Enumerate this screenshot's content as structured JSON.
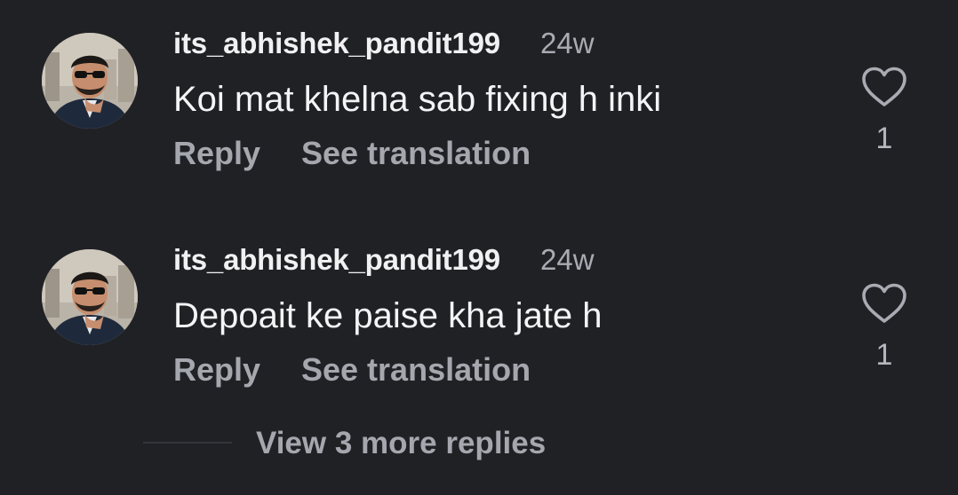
{
  "comments": [
    {
      "username": "its_abhishek_pandit199",
      "timestamp": "24w",
      "text": "Koi mat khelna sab fixing h inki",
      "reply_label": "Reply",
      "translate_label": "See translation",
      "like_count": "1",
      "like_icon": "heart-outline-icon"
    },
    {
      "username": "its_abhishek_pandit199",
      "timestamp": "24w",
      "text": "Depoait ke paise kha jate h",
      "reply_label": "Reply",
      "translate_label": "See translation",
      "like_count": "1",
      "like_icon": "heart-outline-icon"
    }
  ],
  "view_replies_label": "View 3 more replies",
  "colors": {
    "background": "#202125",
    "username": "#f1f1f3",
    "text": "#f4f4f6",
    "secondary": "#a5a7ae"
  }
}
